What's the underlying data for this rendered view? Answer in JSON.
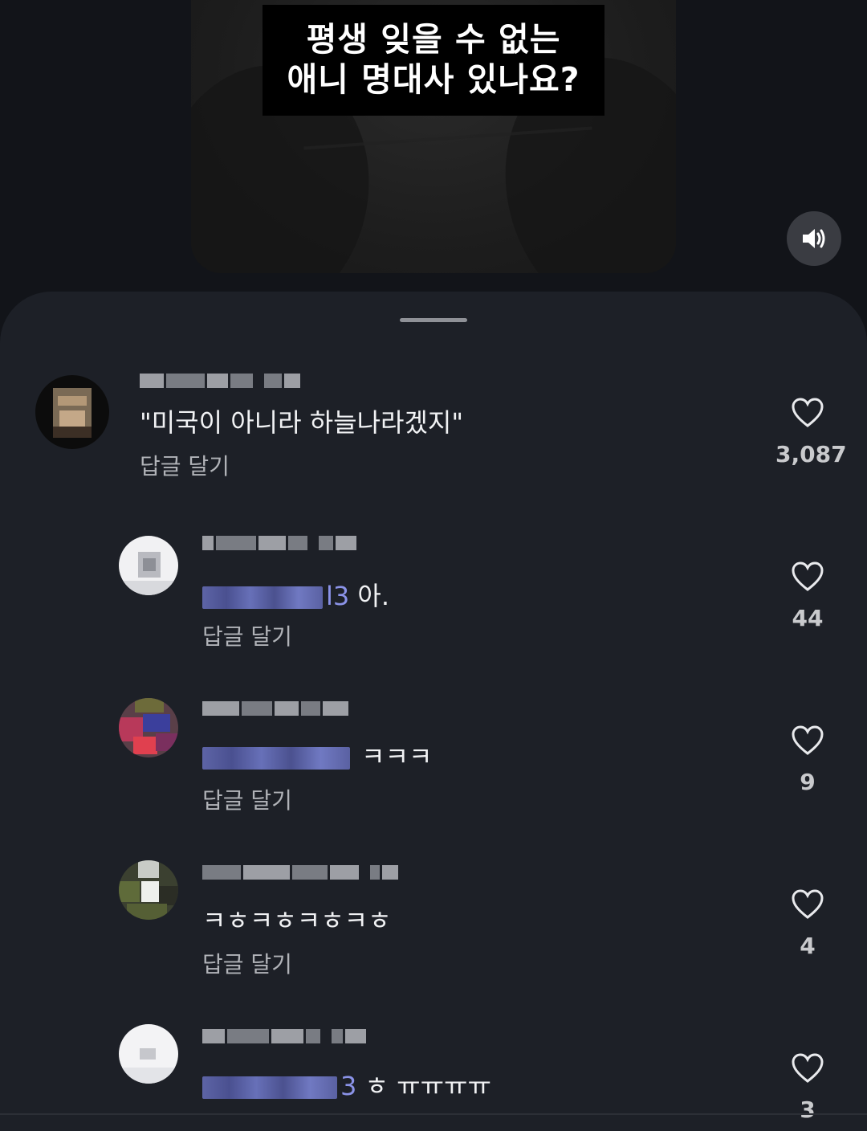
{
  "video": {
    "caption_line1": "평생 잊을 수 없는",
    "caption_line2": "애니 명대사 있나요?",
    "sound_icon": "speaker-volume-icon"
  },
  "comments": [
    {
      "username": "l...l",
      "text": "\"미국이 아니라 하늘나라겠지\"",
      "mention_tail": "",
      "reply_label": "답글 달기",
      "likes": "3,087"
    },
    {
      "username": "j...l",
      "text": "아.",
      "mention_tail": "l3",
      "reply_label": "답글 달기",
      "likes": "44"
    },
    {
      "username": "h...l",
      "text": "ㅋㅋㅋ",
      "mention_tail": "",
      "reply_label": "답글 달기",
      "likes": "9"
    },
    {
      "username": "m...주",
      "text": "ㅋㅎㅋㅎㅋㅎㅋㅎ",
      "mention_tail": "",
      "reply_label": "답글 달기",
      "likes": "4"
    },
    {
      "username": "jj...l",
      "text": "ㅎ ㅠㅠㅠㅠ",
      "mention_tail": "3",
      "reply_label": "",
      "likes": "3"
    }
  ],
  "icons": {
    "like": "heart-outline-icon"
  },
  "colors": {
    "sheet": "#1d2027",
    "background": "#121419",
    "mention": "#8b93e8"
  }
}
